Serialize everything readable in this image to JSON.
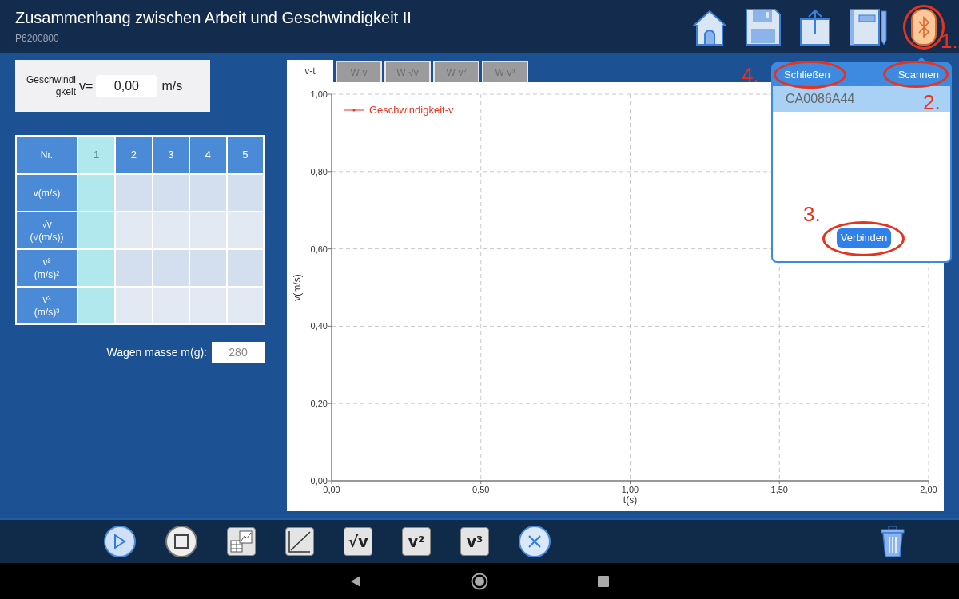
{
  "header": {
    "title": "Zusammenhang zwischen Arbeit und Geschwindigkeit II",
    "subtitle": "P6200800",
    "actions": [
      {
        "kind": "home",
        "selected": false
      },
      {
        "kind": "save",
        "selected": false
      },
      {
        "kind": "export",
        "selected": false
      },
      {
        "kind": "notebook",
        "selected": false
      },
      {
        "kind": "bluetooth",
        "selected": true
      }
    ]
  },
  "speed": {
    "label_lines": [
      "Geschwindi",
      "gkeit"
    ],
    "symbol": "v=",
    "value": "0,00",
    "unit": "m/s"
  },
  "table": {
    "row_header": "Nr.",
    "columns": [
      {
        "label": "1",
        "selected": true
      },
      {
        "label": "2",
        "selected": false
      },
      {
        "label": "3",
        "selected": false
      },
      {
        "label": "4",
        "selected": false
      },
      {
        "label": "5",
        "selected": false
      }
    ],
    "rows": [
      {
        "lines": [
          "v(m/s)"
        ]
      },
      {
        "lines": [
          "√v",
          "(√(m/s))"
        ]
      },
      {
        "lines": [
          "v²",
          "(m/s)²"
        ]
      },
      {
        "lines": [
          "v³",
          "(m/s)³"
        ]
      }
    ]
  },
  "mass": {
    "label": "Wagen masse m(g):",
    "value": "280"
  },
  "tabs": [
    {
      "label": "v-t",
      "selected": true
    },
    {
      "label": "W-v",
      "selected": false
    },
    {
      "label": "W-√v",
      "selected": false
    },
    {
      "label": "W-v²",
      "selected": false
    },
    {
      "label": "W-v³",
      "selected": false
    }
  ],
  "chart_data": {
    "type": "line",
    "grid": true,
    "xlabel": "t(s)",
    "ylabel": "v(m/s)",
    "ylim": [
      0,
      1
    ],
    "categories": [
      "0,00",
      "0,50",
      "1,00",
      "1,50",
      "2,00"
    ],
    "yticks": [
      {
        "value": 0,
        "label": "0,00"
      },
      {
        "value": 0.2,
        "label": "0,20"
      },
      {
        "value": 0.4,
        "label": "0,40"
      },
      {
        "value": 0.6,
        "label": "0,60"
      },
      {
        "value": 0.8,
        "label": "0,80"
      },
      {
        "value": 1,
        "label": "1,00"
      }
    ],
    "series": [
      {
        "name": "Geschwindigkeit-v",
        "color": "#e8321e",
        "values": [
          null,
          null,
          null,
          null,
          null
        ]
      }
    ]
  },
  "popup": {
    "close": "Schließen",
    "scan": "Scannen",
    "devices": [
      {
        "label": "CA0086A44",
        "selected": true
      }
    ],
    "connect": "Verbinden"
  },
  "annotations": [
    "1.",
    "2.",
    "3.",
    "4."
  ],
  "toolbar": [
    {
      "kind": "play"
    },
    {
      "kind": "stop"
    },
    {
      "kind": "table-chart"
    },
    {
      "kind": "line-chart"
    },
    {
      "kind": "formula",
      "label": "√v"
    },
    {
      "kind": "formula",
      "label": "v²"
    },
    {
      "kind": "formula",
      "label": "v³"
    },
    {
      "kind": "clear"
    },
    {
      "kind": "trash"
    }
  ],
  "nav": [
    {
      "kind": "back"
    },
    {
      "kind": "home"
    },
    {
      "kind": "recents"
    }
  ]
}
